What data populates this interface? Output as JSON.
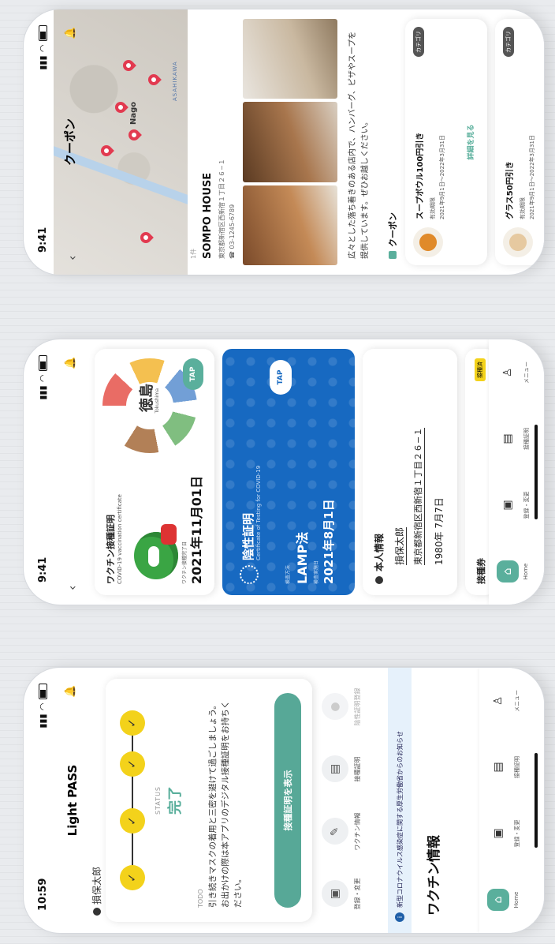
{
  "phone1": {
    "status_time": "10:59",
    "title": "Light PASS",
    "user": "損保太郎",
    "status_label": "STATUS",
    "status_value": "完了",
    "todo_label": "TODO",
    "todo_text": "引き続きマスクの着用と三密を避けて過ごしましょう。お出かけの際は本アプリのデジタル接種証明をお持ちください。",
    "show_button": "接種証明を表示",
    "menu": [
      {
        "label": "登録・変更",
        "icon": "calendar-icon"
      },
      {
        "label": "ワクチン情報",
        "icon": "syringe-icon"
      },
      {
        "label": "接種証明",
        "icon": "certificate-icon"
      },
      {
        "label": "陰性証明登録",
        "icon": "circle-icon"
      }
    ],
    "notice": "新型コロナウイルス感染症に関する厚生労働省からのお知らせ",
    "section_title": "ワクチン情報",
    "nav": [
      {
        "label": "Home",
        "icon": "home-icon"
      },
      {
        "label": "登録・変更",
        "icon": "calendar-icon"
      },
      {
        "label": "接種証明",
        "icon": "certificate-icon"
      },
      {
        "label": "メニュー",
        "icon": "person-icon"
      }
    ]
  },
  "phone2": {
    "status_time": "9:41",
    "vaccine_title": "ワクチン接種証明",
    "vaccine_sub": "COVID-19 vaccination certificate",
    "deco_text": "徳島",
    "deco_sub": "Tokushima",
    "vaccine_date_label": "ワクチン接種完了日",
    "vaccine_date": "2021年11月01日",
    "tap": "TAP",
    "pcr_title": "陰性証明",
    "pcr_sub": "Certificate of Testing for COVID-19",
    "pcr_method_label": "検査方法",
    "pcr_method": "LAMP法",
    "pcr_date_label": "検査実施日",
    "pcr_date": "2021年8月1日",
    "pcr_tap": "TAP",
    "info_title": "本人情報",
    "name": "損保太郎",
    "address": "東京都新宿区西新宿１丁目２６−１",
    "birth": "1980年 7月7日",
    "bottom_title": "接種券",
    "bottom_badge": "接種済",
    "nav": [
      {
        "label": "Home",
        "icon": "home-icon"
      },
      {
        "label": "登録・変更",
        "icon": "calendar-icon"
      },
      {
        "label": "接種証明",
        "icon": "certificate-icon"
      },
      {
        "label": "メニュー",
        "icon": "person-icon"
      }
    ]
  },
  "phone3": {
    "status_time": "9:41",
    "title": "クーポン",
    "map_label": "Nago",
    "map_label2": "ASAHIKAWA",
    "count": "1件",
    "shop_name": "SOMPO HOUSE",
    "address": "東京都新宿区西新宿１丁目２６−１",
    "tel": "03-1245-6789",
    "description": "広々とした落ち着きのある店内で、ハンバーグ、ピザやスープを提供しています。ぜひお越しください。",
    "coupon_head": "クーポン",
    "coupons": [
      {
        "name": "スープボウル100円引き",
        "period_label": "有効期限",
        "period": "2021年9月1日〜2022年3月31日",
        "category": "カテゴリ",
        "more": "詳細を見る"
      },
      {
        "name": "グラス50円引き",
        "period_label": "有効期限",
        "period": "2021年9月1日〜2022年3月31日",
        "category": "カテゴリ",
        "more": ""
      }
    ]
  },
  "colors": {
    "accent": "#5aaf9c",
    "blue": "#1769c1",
    "yellow": "#f3d21b",
    "pin": "#e23a50"
  }
}
